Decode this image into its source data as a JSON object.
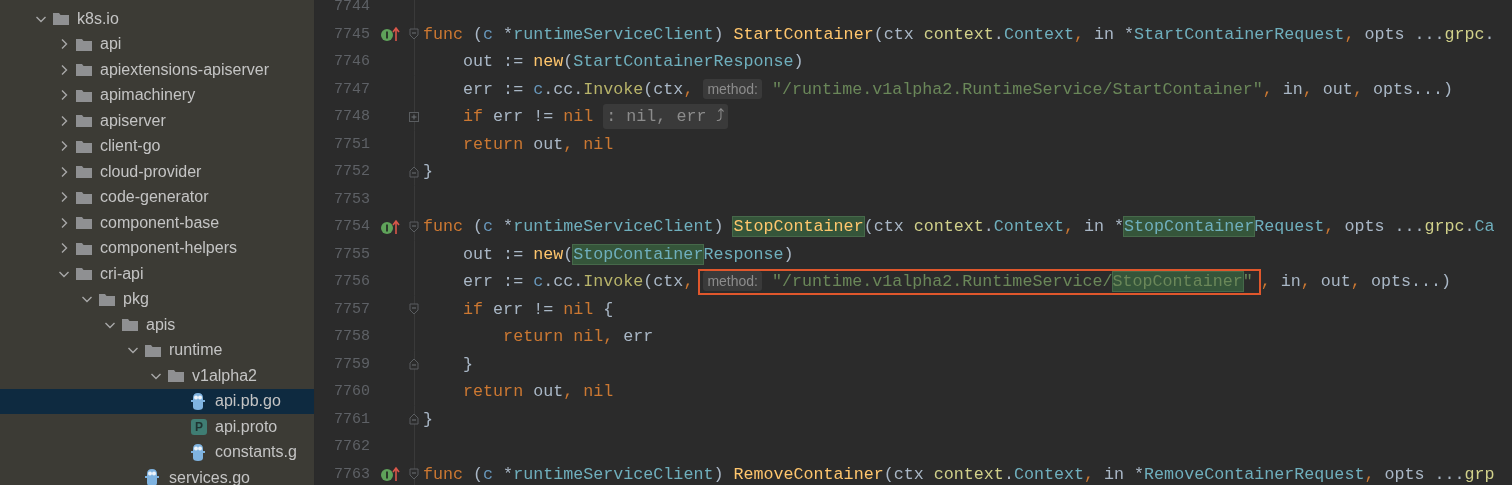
{
  "project_tree": {
    "items": [
      {
        "label": "k8s.io",
        "kind": "folder",
        "expanded": true,
        "selected": false,
        "children": [
          {
            "label": "api",
            "kind": "folder",
            "expanded": false,
            "selected": false
          },
          {
            "label": "apiextensions-apiserver",
            "kind": "folder",
            "expanded": false,
            "selected": false
          },
          {
            "label": "apimachinery",
            "kind": "folder",
            "expanded": false,
            "selected": false
          },
          {
            "label": "apiserver",
            "kind": "folder",
            "expanded": false,
            "selected": false
          },
          {
            "label": "client-go",
            "kind": "folder",
            "expanded": false,
            "selected": false
          },
          {
            "label": "cloud-provider",
            "kind": "folder",
            "expanded": false,
            "selected": false
          },
          {
            "label": "code-generator",
            "kind": "folder",
            "expanded": false,
            "selected": false
          },
          {
            "label": "component-base",
            "kind": "folder",
            "expanded": false,
            "selected": false
          },
          {
            "label": "component-helpers",
            "kind": "folder",
            "expanded": false,
            "selected": false
          },
          {
            "label": "cri-api",
            "kind": "folder",
            "expanded": true,
            "selected": false,
            "children": [
              {
                "label": "pkg",
                "kind": "folder",
                "expanded": true,
                "selected": false,
                "children": [
                  {
                    "label": "apis",
                    "kind": "folder",
                    "expanded": true,
                    "selected": false,
                    "children": [
                      {
                        "label": "runtime",
                        "kind": "folder",
                        "expanded": true,
                        "selected": false,
                        "children": [
                          {
                            "label": "v1alpha2",
                            "kind": "folder",
                            "expanded": true,
                            "selected": false,
                            "children": [
                              {
                                "label": "api.pb.go",
                                "kind": "go",
                                "selected": true
                              },
                              {
                                "label": "api.proto",
                                "kind": "proto",
                                "badge": "P",
                                "selected": false
                              },
                              {
                                "label": "constants.g",
                                "kind": "go",
                                "selected": false
                              }
                            ]
                          }
                        ]
                      },
                      {
                        "label": "services.go",
                        "kind": "go",
                        "selected": false
                      }
                    ]
                  }
                ]
              }
            ]
          }
        ]
      }
    ]
  },
  "editor": {
    "lines": [
      {
        "number": "7744"
      },
      {
        "number": "7745",
        "implements": true,
        "fold": {
          "kind": "start"
        },
        "tokens": [
          {
            "text": "func",
            "kind": "kw"
          },
          {
            "text": " (",
            "kind": "plain"
          },
          {
            "text": "c",
            "kind": "recv"
          },
          {
            "text": " *",
            "kind": "plain"
          },
          {
            "text": "runtimeServiceClient",
            "kind": "type"
          },
          {
            "text": ") ",
            "kind": "plain"
          },
          {
            "text": "StartContainer",
            "kind": "fn"
          },
          {
            "text": "(ctx ",
            "kind": "plain"
          },
          {
            "text": "context",
            "kind": "pkg"
          },
          {
            "text": ".",
            "kind": "plain"
          },
          {
            "text": "Context",
            "kind": "type"
          },
          {
            "text": ",",
            "kind": "punct"
          },
          {
            "text": " in *",
            "kind": "plain"
          },
          {
            "text": "StartContainerRequest",
            "kind": "type"
          },
          {
            "text": ",",
            "kind": "punct"
          },
          {
            "text": " opts ...",
            "kind": "plain"
          },
          {
            "text": "grpc",
            "kind": "pkg"
          },
          {
            "text": ".",
            "kind": "plain"
          }
        ]
      },
      {
        "number": "7746",
        "tokens": [
          {
            "text": "    out := ",
            "kind": "plain"
          },
          {
            "text": "new",
            "kind": "fn"
          },
          {
            "text": "(",
            "kind": "plain"
          },
          {
            "text": "StartContainerResponse",
            "kind": "type"
          },
          {
            "text": ")",
            "kind": "plain"
          }
        ]
      },
      {
        "number": "7747",
        "tokens": [
          {
            "text": "    err := ",
            "kind": "plain"
          },
          {
            "text": "c",
            "kind": "recv"
          },
          {
            "text": ".cc.",
            "kind": "plain"
          },
          {
            "text": "Invoke",
            "kind": "call"
          },
          {
            "text": "(ctx",
            "kind": "plain"
          },
          {
            "text": ", ",
            "kind": "punct"
          },
          {
            "text": "method:",
            "kind": "hint"
          },
          {
            "text": " \"/runtime.v1alpha2.RuntimeService/StartContainer\"",
            "kind": "str"
          },
          {
            "text": ",",
            "kind": "punct"
          },
          {
            "text": " in",
            "kind": "plain"
          },
          {
            "text": ",",
            "kind": "punct"
          },
          {
            "text": " out",
            "kind": "plain"
          },
          {
            "text": ",",
            "kind": "punct"
          },
          {
            "text": " opts...)",
            "kind": "plain"
          }
        ]
      },
      {
        "number": "7748",
        "fold": {
          "kind": "collapsed"
        },
        "tokens": [
          {
            "text": "    if",
            "kind": "kw"
          },
          {
            "text": " err != ",
            "kind": "plain"
          },
          {
            "text": "nil ",
            "kind": "kw"
          },
          {
            "text": ": nil, err ⤴",
            "kind": "placeholder"
          }
        ]
      },
      {
        "number": "7751",
        "tokens": [
          {
            "text": "    return",
            "kind": "kw"
          },
          {
            "text": " out",
            "kind": "plain"
          },
          {
            "text": ", ",
            "kind": "punct"
          },
          {
            "text": "nil",
            "kind": "kw"
          }
        ]
      },
      {
        "number": "7752",
        "fold": {
          "kind": "end"
        },
        "tokens": [
          {
            "text": "}",
            "kind": "plain"
          }
        ]
      },
      {
        "number": "7753"
      },
      {
        "number": "7754",
        "implements": true,
        "fold": {
          "kind": "start"
        },
        "tokens": [
          {
            "text": "func",
            "kind": "kw"
          },
          {
            "text": " (",
            "kind": "plain"
          },
          {
            "text": "c",
            "kind": "recv"
          },
          {
            "text": " *",
            "kind": "plain"
          },
          {
            "text": "runtimeServiceClient",
            "kind": "type"
          },
          {
            "text": ") ",
            "kind": "plain"
          },
          {
            "text": "StopContainer",
            "kind": "fn",
            "highlighted": true
          },
          {
            "text": "(ctx ",
            "kind": "plain"
          },
          {
            "text": "context",
            "kind": "pkg"
          },
          {
            "text": ".",
            "kind": "plain"
          },
          {
            "text": "Context",
            "kind": "type"
          },
          {
            "text": ",",
            "kind": "punct"
          },
          {
            "text": " in *",
            "kind": "plain"
          },
          {
            "text": "StopContainer",
            "kind": "type",
            "highlighted": true
          },
          {
            "text": "Request",
            "kind": "type"
          },
          {
            "text": ",",
            "kind": "punct"
          },
          {
            "text": " opts ...",
            "kind": "plain"
          },
          {
            "text": "grpc",
            "kind": "pkg"
          },
          {
            "text": ".",
            "kind": "plain"
          },
          {
            "text": "Ca",
            "kind": "type"
          }
        ]
      },
      {
        "number": "7755",
        "tokens": [
          {
            "text": "    out := ",
            "kind": "plain"
          },
          {
            "text": "new",
            "kind": "fn"
          },
          {
            "text": "(",
            "kind": "plain"
          },
          {
            "text": "StopContainer",
            "kind": "type",
            "highlighted": true
          },
          {
            "text": "Response",
            "kind": "type"
          },
          {
            "text": ")",
            "kind": "plain"
          }
        ]
      },
      {
        "number": "7756",
        "tokens": [
          {
            "text": "    err := ",
            "kind": "plain"
          },
          {
            "text": "c",
            "kind": "recv"
          },
          {
            "text": ".cc.",
            "kind": "plain"
          },
          {
            "text": "Invoke",
            "kind": "call"
          },
          {
            "text": "(ctx",
            "kind": "plain"
          },
          {
            "text": ", ",
            "kind": "punct"
          },
          {
            "text": "method:",
            "kind": "hint",
            "boxed": true
          },
          {
            "text": " \"/runtime.v1alpha2.RuntimeService/",
            "kind": "str",
            "boxed": true
          },
          {
            "text": "StopContainer",
            "kind": "str",
            "highlighted": true,
            "boxed": true
          },
          {
            "text": "\"",
            "kind": "str",
            "boxed": true
          },
          {
            "text": ",",
            "kind": "punct"
          },
          {
            "text": " in",
            "kind": "plain"
          },
          {
            "text": ",",
            "kind": "punct"
          },
          {
            "text": " out",
            "kind": "plain"
          },
          {
            "text": ",",
            "kind": "punct"
          },
          {
            "text": " opts...)",
            "kind": "plain"
          }
        ]
      },
      {
        "number": "7757",
        "fold": {
          "kind": "start"
        },
        "tokens": [
          {
            "text": "    if",
            "kind": "kw"
          },
          {
            "text": " err != ",
            "kind": "plain"
          },
          {
            "text": "nil",
            "kind": "kw"
          },
          {
            "text": " {",
            "kind": "plain"
          }
        ]
      },
      {
        "number": "7758",
        "tokens": [
          {
            "text": "        return",
            "kind": "kw"
          },
          {
            "text": " nil",
            "kind": "kw"
          },
          {
            "text": ",",
            "kind": "punct"
          },
          {
            "text": " err",
            "kind": "plain"
          }
        ]
      },
      {
        "number": "7759",
        "fold": {
          "kind": "end"
        },
        "tokens": [
          {
            "text": "    }",
            "kind": "plain"
          }
        ]
      },
      {
        "number": "7760",
        "tokens": [
          {
            "text": "    return",
            "kind": "kw"
          },
          {
            "text": " out",
            "kind": "plain"
          },
          {
            "text": ", ",
            "kind": "punct"
          },
          {
            "text": "nil",
            "kind": "kw"
          }
        ]
      },
      {
        "number": "7761",
        "fold": {
          "kind": "end"
        },
        "tokens": [
          {
            "text": "}",
            "kind": "plain"
          }
        ]
      },
      {
        "number": "7762"
      },
      {
        "number": "7763",
        "implements": true,
        "fold": {
          "kind": "start"
        },
        "tokens": [
          {
            "text": "func",
            "kind": "kw"
          },
          {
            "text": " (",
            "kind": "plain"
          },
          {
            "text": "c",
            "kind": "recv"
          },
          {
            "text": " *",
            "kind": "plain"
          },
          {
            "text": "runtimeServiceClient",
            "kind": "type"
          },
          {
            "text": ") ",
            "kind": "plain"
          },
          {
            "text": "RemoveContainer",
            "kind": "fn"
          },
          {
            "text": "(ctx ",
            "kind": "plain"
          },
          {
            "text": "context",
            "kind": "pkg"
          },
          {
            "text": ".",
            "kind": "plain"
          },
          {
            "text": "Context",
            "kind": "type"
          },
          {
            "text": ",",
            "kind": "punct"
          },
          {
            "text": " in *",
            "kind": "plain"
          },
          {
            "text": "RemoveContainerRequest",
            "kind": "type"
          },
          {
            "text": ",",
            "kind": "punct"
          },
          {
            "text": " opts ...",
            "kind": "plain"
          },
          {
            "text": "grp",
            "kind": "pkg"
          }
        ]
      }
    ]
  }
}
